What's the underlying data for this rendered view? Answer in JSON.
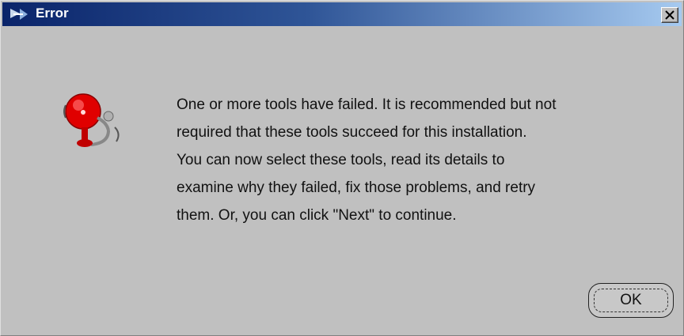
{
  "window": {
    "title": "Error",
    "close_glyph": "×",
    "title_icon": "java-cup-icon",
    "close_icon": "close-icon"
  },
  "dialog": {
    "icon": "alarm-bell-icon",
    "message": "One or more tools have failed. It is recommended but not\nrequired that these tools succeed for this installation.\nYou can now select these tools, read its details to\nexamine why they failed, fix those problems, and retry\nthem. Or, you can click \"Next\" to continue.",
    "ok_label": "OK"
  },
  "colors": {
    "titlebar_start": "#0a246a",
    "titlebar_end": "#a6caf0",
    "window_bg": "#c0c0c0",
    "bell_red": "#e00000"
  }
}
